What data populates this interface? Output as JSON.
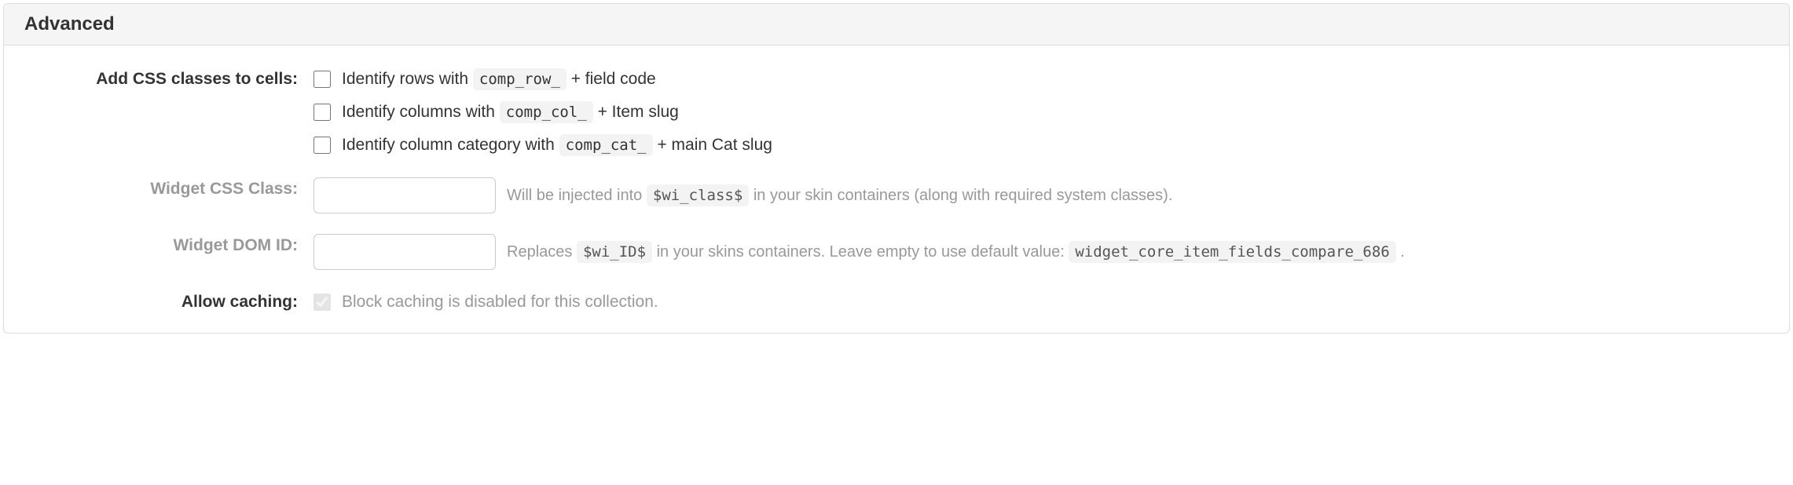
{
  "panel": {
    "title": "Advanced"
  },
  "css_cells": {
    "label": "Add CSS classes to cells:",
    "rows": {
      "pre": "Identify rows with ",
      "code": "comp_row_",
      "post": " + field code"
    },
    "cols": {
      "pre": "Identify columns with ",
      "code": "comp_col_",
      "post": " + Item slug"
    },
    "cats": {
      "pre": "Identify column category with ",
      "code": "comp_cat_",
      "post": " + main Cat slug"
    }
  },
  "css_class": {
    "label": "Widget CSS Class:",
    "value": "",
    "help_pre": "Will be injected into ",
    "help_code": "$wi_class$",
    "help_post": " in your skin containers (along with required system classes)."
  },
  "dom_id": {
    "label": "Widget DOM ID:",
    "value": "",
    "help_pre": "Replaces ",
    "help_code": "$wi_ID$",
    "help_mid": " in your skins containers. Leave empty to use default value: ",
    "help_code2": "widget_core_item_fields_compare_686",
    "help_post": " ."
  },
  "caching": {
    "label": "Allow caching:",
    "note": "Block caching is disabled for this collection."
  }
}
